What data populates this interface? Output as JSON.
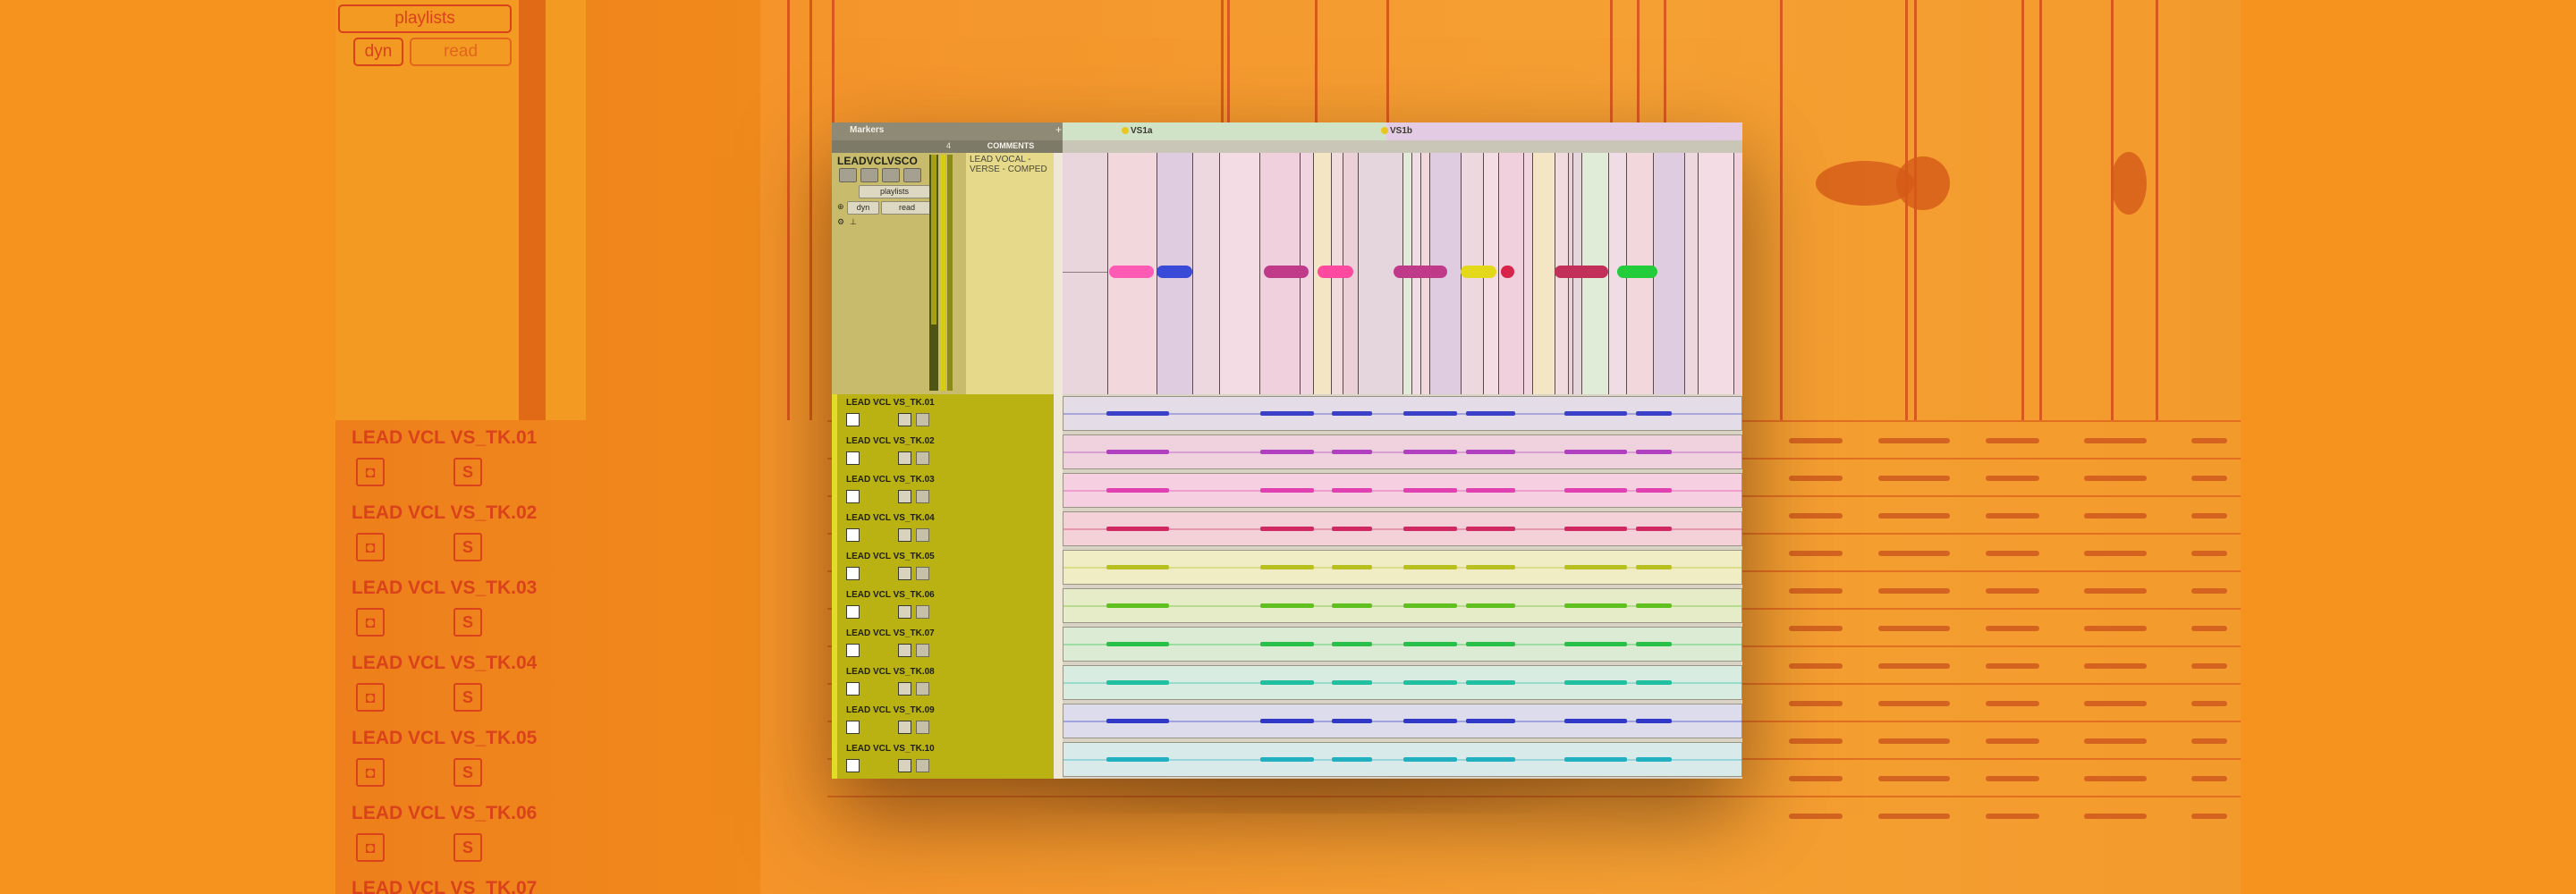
{
  "background": {
    "ghost_playlist_label": "playlists",
    "ghost_dyn_label": "dyn",
    "ghost_read_label": "read",
    "ghost_tracks": [
      "LEAD VCL VS_TK.01",
      "LEAD VCL VS_TK.02",
      "LEAD VCL VS_TK.03",
      "LEAD VCL VS_TK.04",
      "LEAD VCL VS_TK.05",
      "LEAD VCL VS_TK.06",
      "LEAD VCL VS_TK.07"
    ],
    "ghost_btn_a": "◘",
    "ghost_btn_s": "S"
  },
  "ruler": {
    "markers_label": "Markers",
    "add_marker": "+",
    "markers": [
      {
        "name": "VS1a",
        "color": "#e8c820"
      },
      {
        "name": "VS1b",
        "color": "#e8c820"
      }
    ]
  },
  "columns": {
    "count": "4",
    "comments_header": "COMMENTS"
  },
  "comp_track": {
    "name": "LEADVCLVSCO",
    "playlists_label": "playlists",
    "dyn_label": "dyn",
    "read_label": "read",
    "comment": "LEAD VOCAL - VERSE - COMPED",
    "region_colors": [
      "#ff5ab4",
      "#3a4ad8",
      "#c03a8a",
      "#ff4aa0",
      "#e4d81a",
      "#d8244a",
      "#c2305a",
      "#22cc3a"
    ]
  },
  "takes": [
    {
      "name": "LEAD VCL VS_TK.01",
      "lane_color": "#e4dde8",
      "wave_color": "#3a40c8"
    },
    {
      "name": "LEAD VCL VS_TK.02",
      "lane_color": "#f0d2de",
      "wave_color": "#b040c0"
    },
    {
      "name": "LEAD VCL VS_TK.03",
      "lane_color": "#f6d0e0",
      "wave_color": "#e040b0"
    },
    {
      "name": "LEAD VCL VS_TK.04",
      "lane_color": "#f4d0d8",
      "wave_color": "#d02860"
    },
    {
      "name": "LEAD VCL VS_TK.05",
      "lane_color": "#f0ecc4",
      "wave_color": "#b8c020"
    },
    {
      "name": "LEAD VCL VS_TK.06",
      "lane_color": "#e6ecc8",
      "wave_color": "#60c020"
    },
    {
      "name": "LEAD VCL VS_TK.07",
      "lane_color": "#dcecd4",
      "wave_color": "#28c048"
    },
    {
      "name": "LEAD VCL VS_TK.08",
      "lane_color": "#d8ece2",
      "wave_color": "#20c0a0"
    },
    {
      "name": "LEAD VCL VS_TK.09",
      "lane_color": "#dcdcec",
      "wave_color": "#3038c8"
    },
    {
      "name": "LEAD VCL VS_TK.10",
      "lane_color": "#d8eaea",
      "wave_color": "#20b0c0"
    }
  ]
}
